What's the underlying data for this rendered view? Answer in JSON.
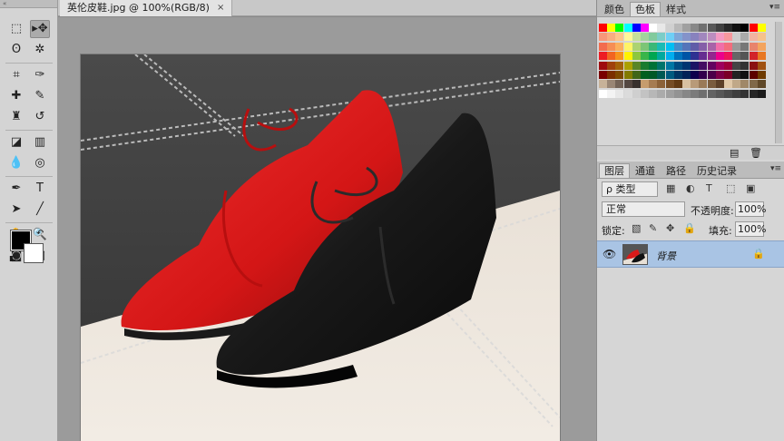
{
  "document": {
    "tab_title": "英伦皮鞋.jpg @ 100%(RGB/8)",
    "close_glyph": "×"
  },
  "toolbox": {
    "grip_label": "«",
    "tools": [
      {
        "name": "marquee-tool-icon",
        "glyph": "⬚"
      },
      {
        "name": "move-tool-icon",
        "glyph": "▸✥",
        "active": true
      },
      {
        "name": "lasso-tool-icon",
        "glyph": "ʘ"
      },
      {
        "name": "magic-wand-tool-icon",
        "glyph": "✲"
      },
      {
        "name": "crop-tool-icon",
        "glyph": "⌗"
      },
      {
        "name": "eyedropper-tool-icon",
        "glyph": "✑"
      },
      {
        "name": "healing-brush-tool-icon",
        "glyph": "✚"
      },
      {
        "name": "brush-tool-icon",
        "glyph": "✎"
      },
      {
        "name": "clone-stamp-tool-icon",
        "glyph": "♜"
      },
      {
        "name": "history-brush-tool-icon",
        "glyph": "↺"
      },
      {
        "name": "eraser-tool-icon",
        "glyph": "◪"
      },
      {
        "name": "gradient-tool-icon",
        "glyph": "▥"
      },
      {
        "name": "blur-tool-icon",
        "glyph": "💧"
      },
      {
        "name": "dodge-tool-icon",
        "glyph": "◎"
      },
      {
        "name": "pen-tool-icon",
        "glyph": "✒"
      },
      {
        "name": "type-tool-icon",
        "glyph": "T"
      },
      {
        "name": "path-selection-tool-icon",
        "glyph": "➤"
      },
      {
        "name": "line-tool-icon",
        "glyph": "╱"
      },
      {
        "name": "hand-tool-icon",
        "glyph": "✋"
      },
      {
        "name": "zoom-tool-icon",
        "glyph": "🔍"
      },
      {
        "name": "quick-mask-icon",
        "glyph": "◙"
      },
      {
        "name": "screen-mode-icon",
        "glyph": "▣"
      }
    ],
    "swap_glyph": "↶",
    "reset_glyph": "◧"
  },
  "swatches_panel": {
    "tabs": [
      "颜色",
      "色板",
      "样式"
    ],
    "active_tab": 1,
    "menu_glyph": "▾≡",
    "new_glyph": "▤",
    "delete_glyph": "🗑"
  },
  "layers_panel": {
    "tabs": [
      "图层",
      "通道",
      "路径",
      "历史记录"
    ],
    "active_tab": 0,
    "menu_glyph": "▾≡",
    "filter_label": "ρ 类型",
    "blend_mode": "正常",
    "opacity_label": "不透明度:",
    "opacity_value": "100%",
    "lock_label": "锁定:",
    "fill_label": "填充:",
    "fill_value": "100%",
    "layer_name": "背景",
    "eye_glyph": "👁",
    "lock_glyph": "🔒"
  },
  "colors": {
    "accent_selection": "#a9c4e4",
    "shoe_red": "#d81a1a",
    "shoe_black": "#141414"
  }
}
